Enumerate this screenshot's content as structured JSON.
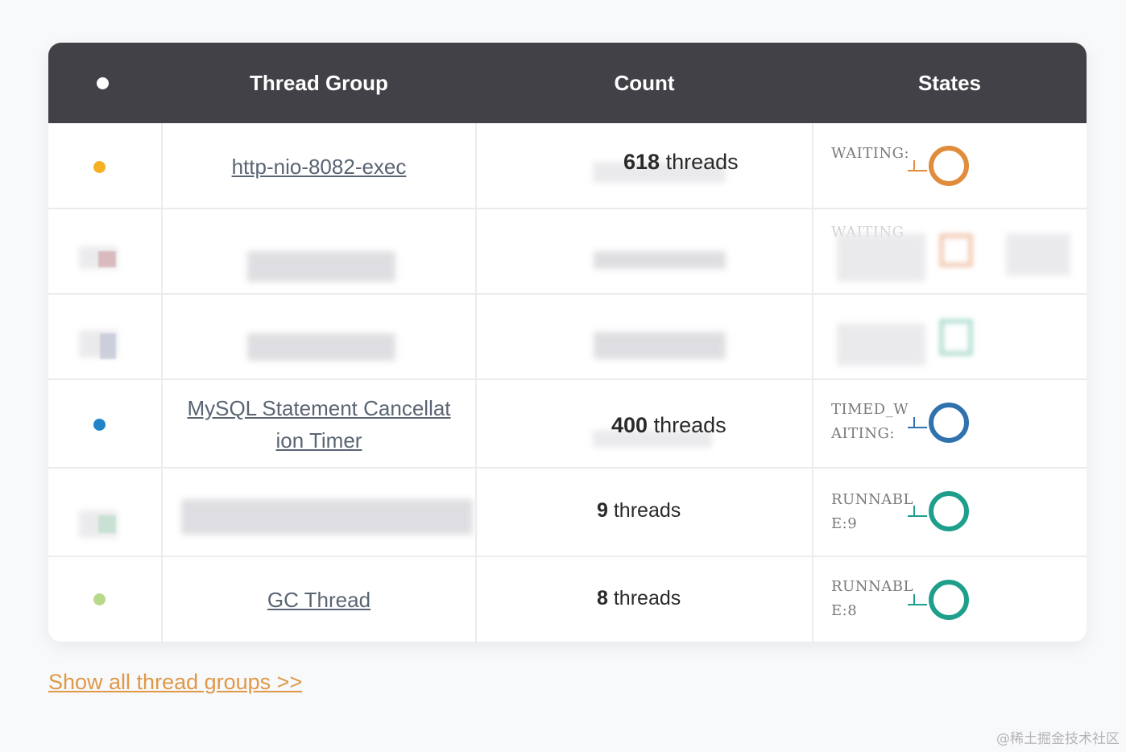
{
  "table": {
    "headers": {
      "thread_group": "Thread Group",
      "count": "Count",
      "states": "States"
    },
    "rows": [
      {
        "dot_color": "#f5b121",
        "group": "http-nio-8082-exec",
        "count_num": "618",
        "count_unit": "threads",
        "state": "WAITING:",
        "ring_color": "#e08c3c"
      },
      {
        "dot_color": "#cf9ba0",
        "group": "",
        "count_num": "",
        "count_unit": "",
        "state": "WAITING",
        "ring_color": "#eaa781"
      },
      {
        "dot_color": "#b9bdd0",
        "group": "",
        "count_num": "",
        "count_unit": "",
        "state": "",
        "ring_color": "#73c2ad"
      },
      {
        "dot_color": "#2184c9",
        "group": "MySQL Statement Cancellat ion Timer",
        "count_num": "400",
        "count_unit": "threads",
        "state": "TIMED_W AITING:",
        "ring_color": "#2f72ad"
      },
      {
        "dot_color": "#b3dcc4",
        "group": "",
        "count_num": "9",
        "count_unit": "threads",
        "state": "RUNNABL E:9",
        "ring_color": "#1e9f8c"
      },
      {
        "dot_color": "#b9d98a",
        "group": "GC Thread",
        "count_num": "8",
        "count_unit": "threads",
        "state": "RUNNABL E:8",
        "ring_color": "#1e9f8c"
      }
    ]
  },
  "footer": {
    "show_all_link": "Show all thread groups >>"
  },
  "watermark": "@稀土掘金技术社区"
}
